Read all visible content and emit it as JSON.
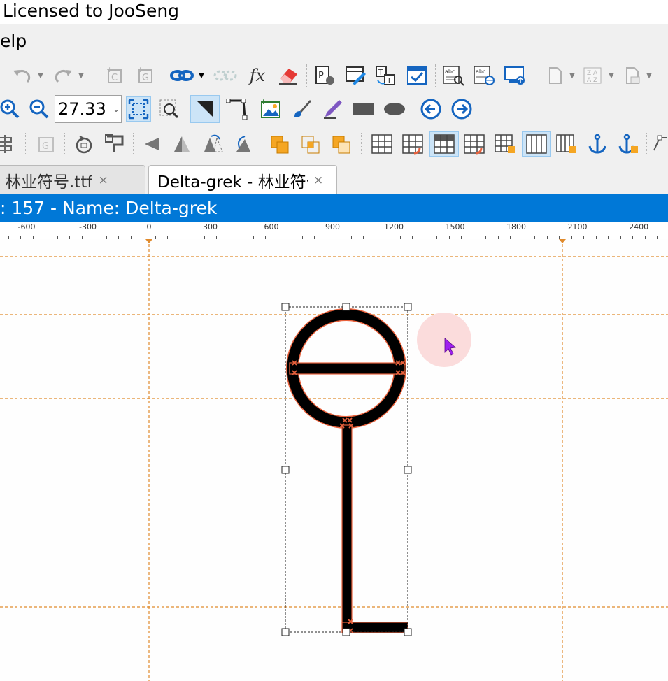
{
  "window": {
    "title": "Licensed to JooSeng"
  },
  "menu": {
    "help_label": "elp"
  },
  "toolbar": {
    "zoom_value": "27.33",
    "row1_icons": [
      "undo-icon",
      "redo-icon",
      "add-contour-icon",
      "add-glyph-icon",
      "link-icon",
      "unlink-icon",
      "function-icon",
      "eraser-icon",
      "glyph-properties-icon",
      "edit-metrics-icon",
      "text-transform-icon",
      "validate-icon",
      "spell-check-icon",
      "web-check-icon",
      "export-icon",
      "new-document-icon",
      "sort-icon",
      "page-setup-icon"
    ],
    "row2_icons": [
      "zoom-in-icon",
      "zoom-out-icon",
      "fit-to-window-icon",
      "zoom-rect-icon",
      "pointer-tool-icon",
      "node-tool-icon",
      "insert-image-icon",
      "brush-icon",
      "pen-icon",
      "rectangle-icon",
      "ellipse-icon",
      "previous-glyph-icon",
      "next-glyph-icon"
    ],
    "row3_icons": [
      "align-icon",
      "glyph-gray-icon",
      "rotate-icon",
      "flip-icon",
      "triangle-left-icon",
      "triangle-center-icon",
      "triangle-skew-icon",
      "triangle-rotate-icon",
      "union-icon",
      "intersect-icon",
      "subtract-icon",
      "grid-icon",
      "grid-undo-icon",
      "grid-active-icon",
      "grid-redo-icon",
      "grid-lock-icon",
      "grid-columns-icon",
      "grid-columns-lock-icon",
      "anchor-icon",
      "anchor-lock-icon",
      "path-icon"
    ]
  },
  "tabs": [
    {
      "label": "林业符号.ttf",
      "close": "×"
    },
    {
      "label": "Delta-grek - 林业符号.ttf",
      "close": "×"
    }
  ],
  "status": {
    "text": ": 157 - Name: Delta-grek"
  },
  "ruler": {
    "labels": [
      "-600",
      "-300",
      "0",
      "300",
      "600",
      "900",
      "1200",
      "1500",
      "1800",
      "2100",
      "2400"
    ]
  },
  "canvas": {
    "guide_color": "#e08a2c",
    "glyph_fill": "#000000",
    "glyph_outline": "#e8613c",
    "cursor_color": "#a020f0",
    "cursor_highlight": "#fbd8d8"
  }
}
